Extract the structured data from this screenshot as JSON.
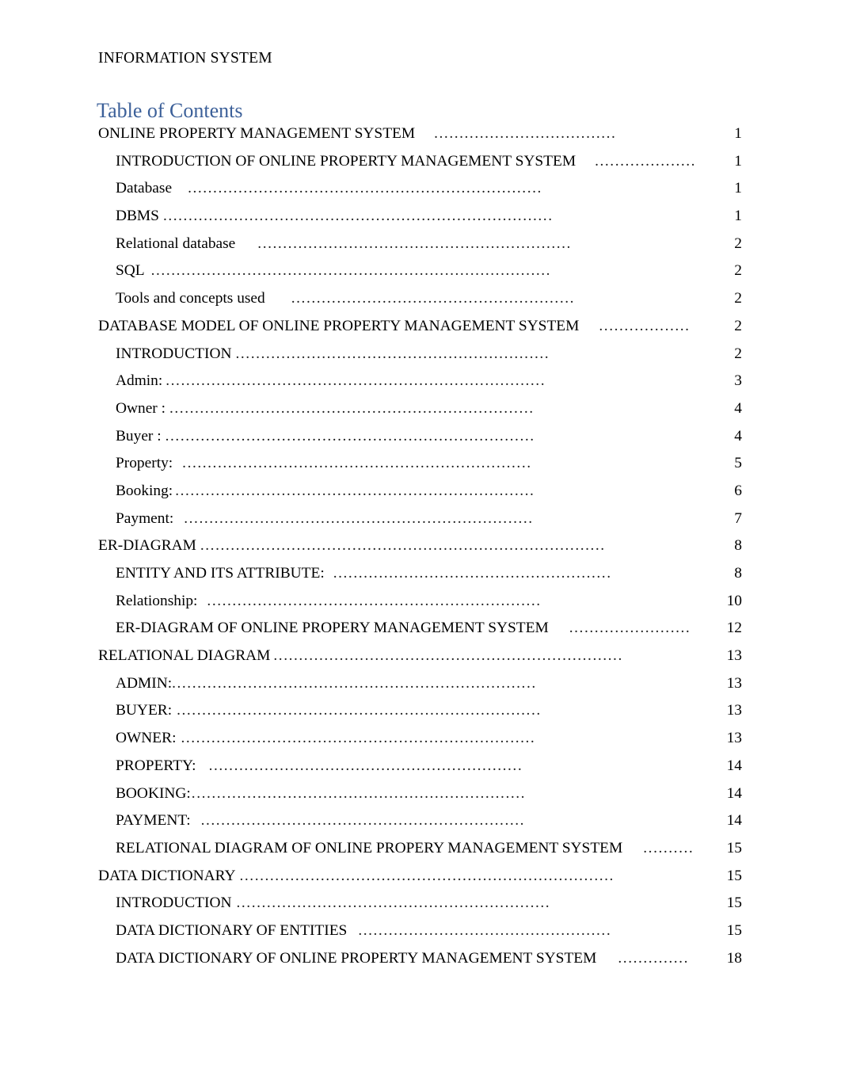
{
  "document": {
    "running_header": "INFORMATION SYSTEM",
    "toc_heading": "Table of Contents",
    "heading_color": "#3C6099"
  },
  "toc": {
    "entries": [
      {
        "label": "ONLINE PROPERTY MANAGEMENT SYSTEM",
        "page": "1",
        "level": 1,
        "gap": 24,
        "dots_width": 250
      },
      {
        "label": "INTRODUCTION OF ONLINE PROPERTY MANAGEMENT SYSTEM",
        "page": "1",
        "level": 2,
        "gap": 24,
        "dots_width": 140
      },
      {
        "label": "Database",
        "page": "1",
        "level": 2,
        "gap": 20,
        "dots_width": 480
      },
      {
        "label": "DBMS",
        "page": "1",
        "level": 2,
        "gap": 5,
        "dots_width": 530
      },
      {
        "label": "Relational database",
        "page": "2",
        "level": 2,
        "gap": 28,
        "dots_width": 430
      },
      {
        "label": "SQL",
        "page": "2",
        "level": 2,
        "gap": 8,
        "dots_width": 545
      },
      {
        "label": "Tools and concepts used",
        "page": "2",
        "level": 2,
        "gap": 33,
        "dots_width": 385
      },
      {
        "label": "DATABASE MODEL OF ONLINE PROPERTY MANAGEMENT SYSTEM",
        "page": "2",
        "level": 1,
        "gap": 25,
        "dots_width": 125
      },
      {
        "label": "INTRODUCTION",
        "page": "2",
        "level": 2,
        "gap": 5,
        "dots_width": 430
      },
      {
        "label": "Admin:",
        "page": "3",
        "level": 2,
        "gap": 4,
        "dots_width": 515
      },
      {
        "label": "Owner :",
        "page": "4",
        "level": 2,
        "gap": 5,
        "dots_width": 500
      },
      {
        "label": "Buyer :",
        "page": "4",
        "level": 2,
        "gap": 5,
        "dots_width": 505
      },
      {
        "label": "Property:",
        "page": "5",
        "level": 2,
        "gap": 12,
        "dots_width": 478
      },
      {
        "label": "Booking:",
        "page": "6",
        "level": 2,
        "gap": 3,
        "dots_width": 490
      },
      {
        "label": "Payment:",
        "page": "7",
        "level": 2,
        "gap": 13,
        "dots_width": 475
      },
      {
        "label": "ER-DIAGRAM",
        "page": "8",
        "level": 1,
        "gap": 5,
        "dots_width": 555
      },
      {
        "label": "ENTITY AND ITS ATTRIBUTE:",
        "page": "8",
        "level": 2,
        "gap": 11,
        "dots_width": 380
      },
      {
        "label": "Relationship:",
        "page": "10",
        "level": 2,
        "gap": 12,
        "dots_width": 455
      },
      {
        "label": "ER-DIAGRAM OF ONLINE PROPERY MANAGEMENT SYSTEM",
        "page": "12",
        "level": 2,
        "gap": 26,
        "dots_width": 165
      },
      {
        "label": "RELATIONAL DIAGRAM",
        "page": "13",
        "level": 1,
        "gap": 4,
        "dots_width": 475
      },
      {
        "label": "ADMIN:",
        "page": "13",
        "level": 2,
        "gap": 0,
        "dots_width": 500
      },
      {
        "label": "BUYER:",
        "page": "13",
        "level": 2,
        "gap": 6,
        "dots_width": 495
      },
      {
        "label": "OWNER:",
        "page": "13",
        "level": 2,
        "gap": 6,
        "dots_width": 485
      },
      {
        "label": "PROPERTY:",
        "page": "14",
        "level": 2,
        "gap": 16,
        "dots_width": 430
      },
      {
        "label": "BOOKING:",
        "page": "14",
        "level": 2,
        "gap": 1,
        "dots_width": 455
      },
      {
        "label": "PAYMENT:",
        "page": "14",
        "level": 2,
        "gap": 13,
        "dots_width": 440
      },
      {
        "label": "RELATIONAL DIAGRAM OF ONLINE PROPERY MANAGEMENT SYSTEM",
        "page": "15",
        "level": 2,
        "gap": 26,
        "dots_width": 68
      },
      {
        "label": "DATA DICTIONARY",
        "page": "15",
        "level": 1,
        "gap": 5,
        "dots_width": 510
      },
      {
        "label": "INTRODUCTION",
        "page": "15",
        "level": 2,
        "gap": 6,
        "dots_width": 425
      },
      {
        "label": "DATA DICTIONARY OF ENTITIES",
        "page": "15",
        "level": 2,
        "gap": 14,
        "dots_width": 345
      },
      {
        "label": "DATA DICTIONARY OF ONLINE PROPERTY MANAGEMENT SYSTEM",
        "page": "18",
        "level": 2,
        "gap": 27,
        "dots_width": 98
      }
    ]
  }
}
